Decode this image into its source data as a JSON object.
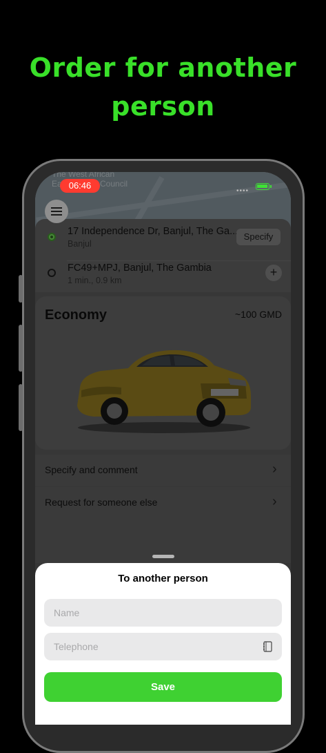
{
  "headline": {
    "line1": "Order for another",
    "line2": "person"
  },
  "status_bar": {
    "time": "06:46"
  },
  "map": {
    "label_line1": "The West African",
    "label_line2": "Ea",
    "label_line3": "Council"
  },
  "route": {
    "pickup": {
      "address": "17 Independence Dr, Banjul, The Ga...",
      "city": "Banjul",
      "action_label": "Specify"
    },
    "destination": {
      "address": "FC49+MPJ, Banjul, The Gambia",
      "eta": "1 min., 0.9 km",
      "action_label": "+"
    }
  },
  "tariff": {
    "name": "Economy",
    "price": "~100 GMD"
  },
  "options": [
    {
      "label": "Specify and comment",
      "chevron": "›"
    },
    {
      "label": "Request for someone else",
      "chevron": "›"
    }
  ],
  "sheet": {
    "title": "To another person",
    "name_placeholder": "Name",
    "phone_placeholder": "Telephone",
    "save_label": "Save"
  },
  "colors": {
    "accent": "#3fd132",
    "headline": "#39e029",
    "time_badge": "#ff3b30"
  },
  "icons": [
    "menu-icon",
    "contacts-book-icon",
    "chevron-right-icon",
    "plus-icon",
    "battery-icon",
    "taxi-car-image"
  ]
}
